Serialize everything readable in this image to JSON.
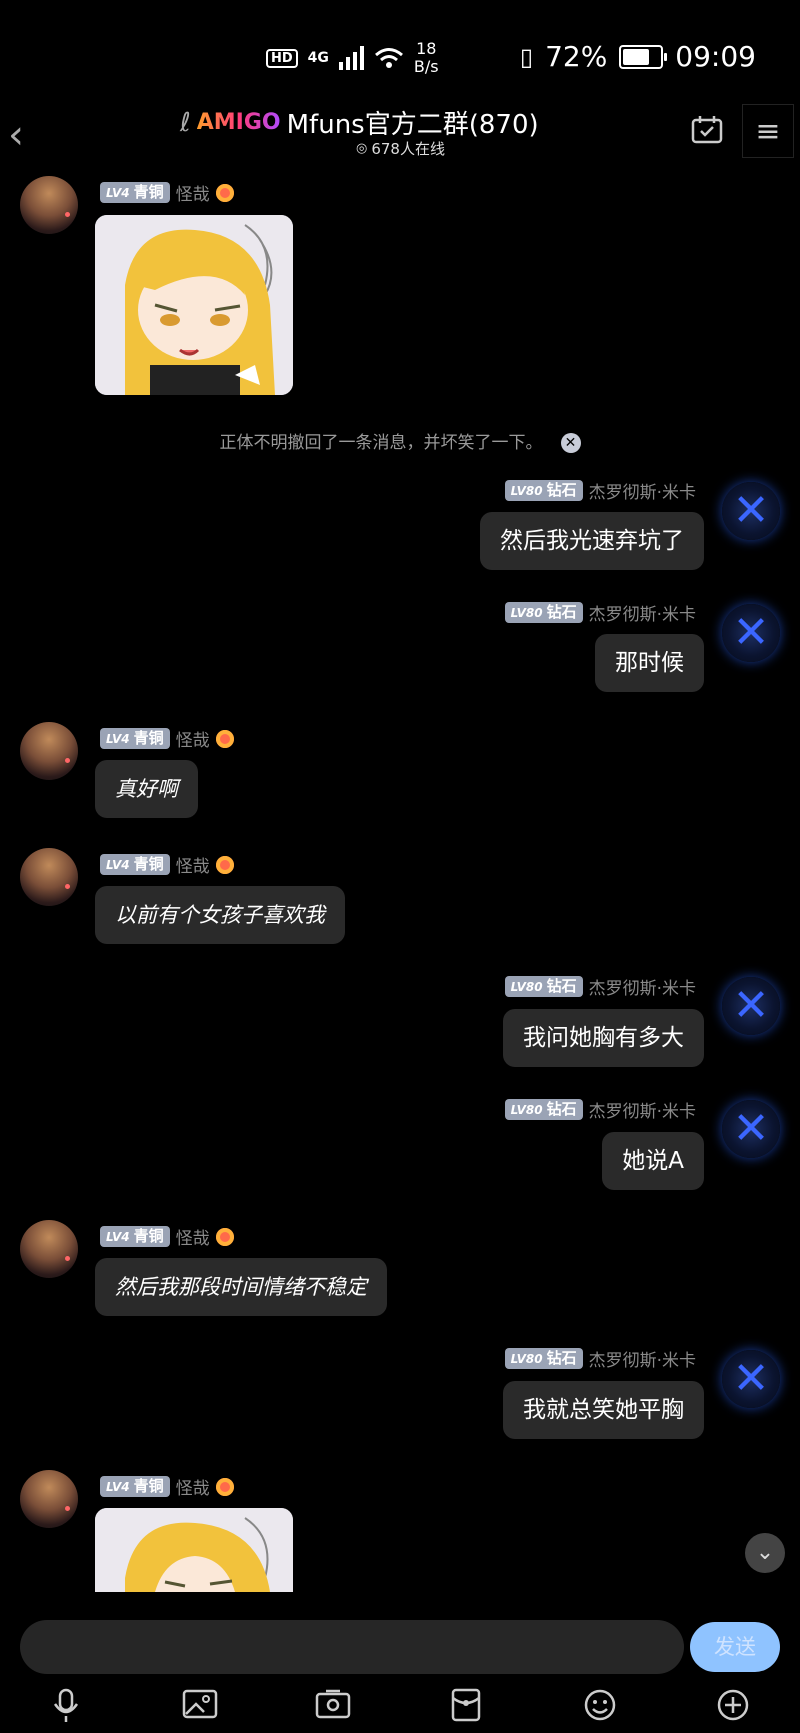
{
  "status": {
    "hd": "HD",
    "network": "4G",
    "speed_value": "18",
    "speed_unit": "B/s",
    "battery_pct": "72%",
    "battery_level": 0.72,
    "time": "09:09"
  },
  "header": {
    "logo": "AMIGO",
    "title": "Mfuns官方二群(870)",
    "online": "678人在线"
  },
  "users": {
    "left": {
      "level": "LV4",
      "rank": "青铜",
      "name": "怪哉"
    },
    "right": {
      "level": "LV80",
      "rank": "钻石",
      "name": "杰罗彻斯·米卡"
    }
  },
  "system_notice": "正体不明撤回了一条消息，并坏笑了一下。",
  "messages": [
    {
      "side": "left",
      "type": "sticker"
    },
    {
      "side": "right",
      "type": "text",
      "text": "然后我光速弃坑了"
    },
    {
      "side": "right",
      "type": "text",
      "text": "那时候"
    },
    {
      "side": "left",
      "type": "text",
      "text": "真好啊"
    },
    {
      "side": "left",
      "type": "text",
      "text": "以前有个女孩子喜欢我"
    },
    {
      "side": "right",
      "type": "text",
      "text": "我问她胸有多大"
    },
    {
      "side": "right",
      "type": "text",
      "text": "她说A"
    },
    {
      "side": "left",
      "type": "text",
      "text": "然后我那段时间情绪不稳定"
    },
    {
      "side": "right",
      "type": "text",
      "text": "我就总笑她平胸"
    },
    {
      "side": "left",
      "type": "sticker"
    }
  ],
  "input": {
    "send_label": "发送"
  },
  "icons": {
    "back": "chevron-left-icon",
    "calendar": "calendar-check-icon",
    "menu": "menu-icon",
    "toolbar": [
      "microphone-icon",
      "image-icon",
      "camera-icon",
      "red-packet-icon",
      "emoji-icon",
      "plus-icon"
    ]
  }
}
